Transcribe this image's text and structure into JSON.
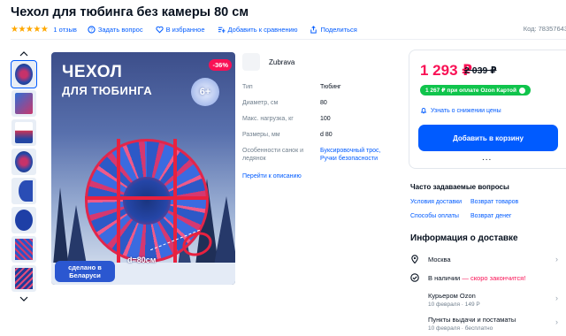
{
  "product": {
    "title": "Чехол для тюбинга без камеры 80 см",
    "stars": "★★★★★",
    "reviews": "1 отзыв",
    "code": "Код: 78357643"
  },
  "actions": [
    {
      "label": "Задать вопрос",
      "icon": "question-icon"
    },
    {
      "label": "В избранное",
      "icon": "heart-icon"
    },
    {
      "label": "Добавить к сравнению",
      "icon": "compare-icon"
    },
    {
      "label": "Поделиться",
      "icon": "share-icon"
    }
  ],
  "image": {
    "title1": "ЧЕХОЛ",
    "title2": "ДЛЯ ТЮБИНГА",
    "discount": "-36%",
    "age": "6+",
    "made_in_line1": "сделано в",
    "made_in_line2": "Беларуси",
    "dimension": "d=80см"
  },
  "brand": {
    "name": "Zubrava"
  },
  "specs": [
    {
      "key": "Тип",
      "value": "Тюбинг"
    },
    {
      "key": "Диаметр, см",
      "value": "80"
    },
    {
      "key": "Макс. нагрузка, кг",
      "value": "100"
    },
    {
      "key": "Размеры, мм",
      "value": "d 80"
    },
    {
      "key": "Особенности санок и ледянок",
      "value": "Буксировочный трос, Ручки безопасности"
    }
  ],
  "to_description": "Перейти к описанию",
  "buy": {
    "price": "1 293 ₽",
    "old_price": "2 039 ₽",
    "ozon_price": "1 267 ₽ при оплате Ozon Картой",
    "notify": "Узнать о снижении цены",
    "cart_button": "Добавить в корзину",
    "more": "..."
  },
  "faq": {
    "title": "Часто задаваемые вопросы",
    "links": [
      "Условия доставки",
      "Возврат товаров",
      "Способы оплаты",
      "Возврат денег"
    ]
  },
  "delivery": {
    "title": "Информация о доставке",
    "city": "Москва",
    "stock_prefix": "В наличии",
    "stock_warning": "— скоро закончится!",
    "courier": "Курьером Ozon",
    "courier_sub": "10 февраля · 149 Р",
    "pickup": "Пункты выдачи и постаматы",
    "pickup_sub": "10 февраля · бесплатно"
  },
  "colors": {
    "accent": "#005bff",
    "sale": "#f91155",
    "ozon_card": "#10c44c",
    "stars": "#ffa800"
  }
}
